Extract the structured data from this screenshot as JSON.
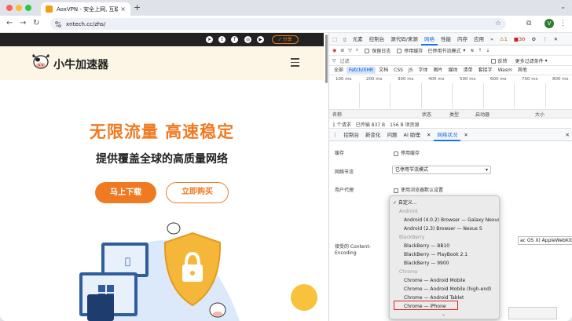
{
  "browser": {
    "tab_title": "AoxVPN - 安全上网, 互联世界",
    "tab_close": "×",
    "new_tab": "+",
    "url": "xntech.cc/zhs/",
    "avatar_letter": "V"
  },
  "site": {
    "share_label": "分享",
    "brand": "小牛加速器",
    "hero_title": "无限流量 高速稳定",
    "hero_subtitle": "提供覆盖全球的高质量网络",
    "btn_download": "马上下载",
    "btn_buy": "立即购买",
    "accent": "#f07a22"
  },
  "devtools": {
    "tabs": [
      "元素",
      "控制台",
      "源代码/来源",
      "网络",
      "性能",
      "内存",
      "应用"
    ],
    "active_tab": "网络",
    "warnings": "1",
    "errors": "30",
    "preserve_log": "保留日志",
    "disable_cache": "停用缓存",
    "throttle": "已停用节流模式",
    "filter_placeholder": "过滤",
    "invert": "反转",
    "more_filters": "更多过滤条件",
    "types": [
      "全部",
      "Fetch/XHR",
      "文档",
      "CSS",
      "JS",
      "字体",
      "图片",
      "媒体",
      "清单",
      "套接字",
      "Wasm",
      "其他"
    ],
    "active_type": "Fetch/XHR",
    "ticks": [
      "100 ms",
      "200 ms",
      "300 ms",
      "400 ms",
      "500 ms",
      "600 ms",
      "700 ms",
      "800 ms"
    ],
    "columns": [
      "名称",
      "状态",
      "类型",
      "启动器",
      "大小"
    ],
    "status": [
      "1 个请求",
      "已传输 837 B",
      "156 B 项资源"
    ],
    "drawer_tabs": [
      "控制台",
      "新变化",
      "问题",
      "AI 助理",
      "网络状况"
    ],
    "active_drawer": "网络状况",
    "cache_label": "缓存",
    "disable_cache_opt": "停用缓存",
    "throttle_label": "网络节流",
    "throttle_value": "已停用节流模式",
    "ua_label": "用户代理",
    "ua_default": "使用浏览器默认设置",
    "ua_value": "ac OS X) AppleWebKit/6",
    "content_enc_label": "接受的 Content-Encoding"
  },
  "dropdown": {
    "selected": "✓ 自定义...",
    "groups": [
      {
        "name": "Android",
        "items": [
          "Android (4.0.2) Browser — Galaxy Nexus",
          "Android (2.3) Browser — Nexus S"
        ]
      },
      {
        "name": "BlackBerry",
        "items": [
          "BlackBerry — BB10",
          "BlackBerry — PlayBook 2.1",
          "BlackBerry — 9900"
        ]
      },
      {
        "name": "Chrome",
        "items": [
          "Chrome — Android Mobile",
          "Chrome — Android Mobile (high-end)",
          "Chrome — Android Tablet",
          "Chrome — iPhone"
        ]
      }
    ],
    "highlighted": "Chrome — iPhone",
    "more": "⌄"
  }
}
